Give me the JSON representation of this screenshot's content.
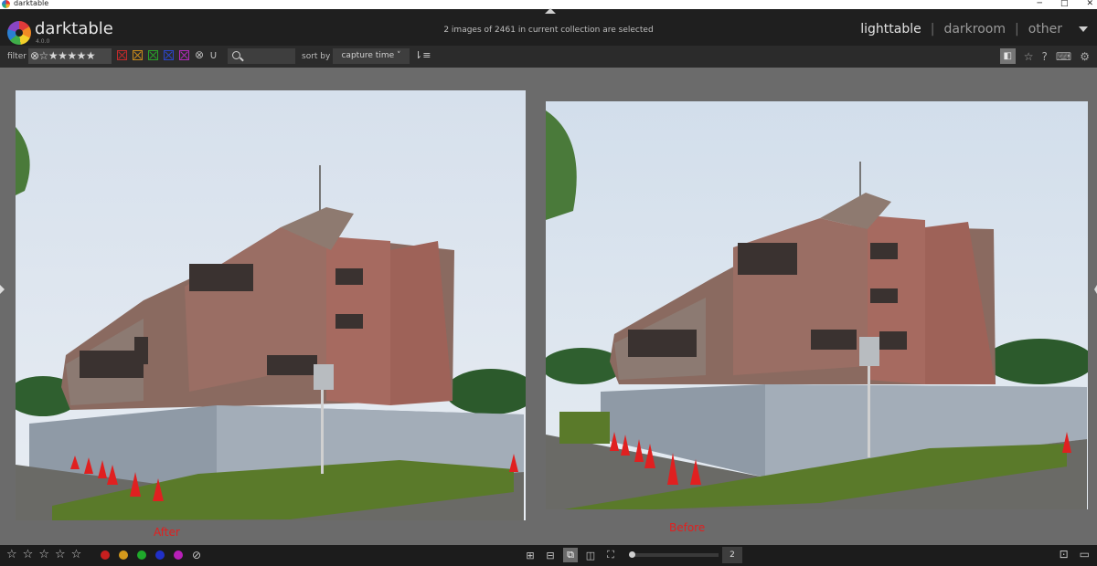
{
  "os_window": {
    "title": "darktable"
  },
  "header": {
    "app_name": "darktable",
    "version": "4.0.0",
    "selection_status": "2 images of 2461 in current collection are selected",
    "views": [
      {
        "label": "lighttable",
        "active": true
      },
      {
        "label": "darkroom",
        "active": false
      },
      {
        "label": "other",
        "active": false
      }
    ]
  },
  "toolbar": {
    "filter_label": "filter",
    "rating_filter": "⊗☆★★★★★",
    "color_filters": [
      "red",
      "yellow",
      "green",
      "blue",
      "purple",
      "gray"
    ],
    "search": {
      "placeholder": "",
      "value": ""
    },
    "sort_label": "sort by",
    "sort_value": "capture time",
    "icons": [
      "search-icon",
      "sort-direction-icon",
      "overlay-icon",
      "star-icon",
      "help-icon",
      "keyboard-icon",
      "gear-icon"
    ]
  },
  "images": [
    {
      "caption": "After",
      "position": "left"
    },
    {
      "caption": "Before",
      "position": "right"
    }
  ],
  "bottom_bar": {
    "star_count": 5,
    "color_labels": [
      "#c81f1f",
      "#d49a1c",
      "#1faa2b",
      "#2030c8",
      "#b81fb8"
    ],
    "layout_modes": [
      "filemanager",
      "zoomable",
      "culling-fixed",
      "culling-dynamic",
      "preview"
    ],
    "active_layout": "culling-fixed",
    "zoom_count": "2"
  }
}
